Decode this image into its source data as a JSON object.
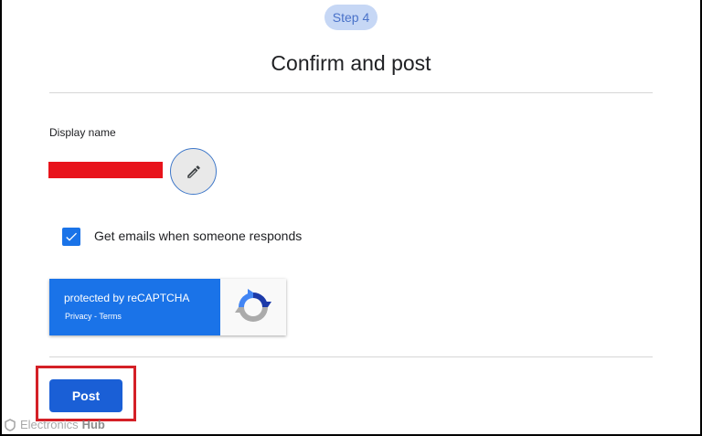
{
  "step": {
    "label": "Step 4"
  },
  "header": {
    "title": "Confirm and post"
  },
  "display_name": {
    "label": "Display name",
    "value_redacted": true,
    "redaction_color": "#e8131b"
  },
  "edit_icon": "pencil-icon",
  "emails_option": {
    "label": "Get emails when someone responds",
    "checked": true
  },
  "recaptcha": {
    "protected_text": "protected by reCAPTCHA",
    "privacy": "Privacy",
    "separator": " - ",
    "terms": "Terms"
  },
  "post_button": {
    "label": "Post",
    "color": "#1a5fd6"
  },
  "highlight_color": "#d42027",
  "watermark": {
    "brand_part1": "Electronics",
    "brand_part2": "Hub"
  }
}
